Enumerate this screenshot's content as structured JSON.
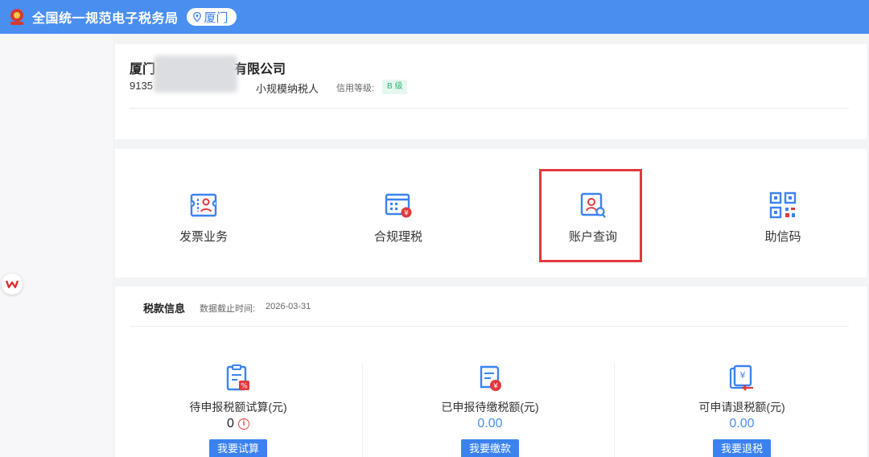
{
  "header": {
    "title": "全国统一规范电子税务局",
    "city": "厦门",
    "colors": {
      "bar": "#4a8ff0",
      "accent": "#3a7de8"
    }
  },
  "company": {
    "name_prefix": "厦门",
    "name_suffix": "有限公司",
    "id_prefix": "9135",
    "taxpayer_type": "小规模纳税人",
    "credit_label": "信用等级:",
    "credit_grade": "B 级"
  },
  "quick_actions": [
    {
      "label": "发票业务",
      "icon": "invoice-icon"
    },
    {
      "label": "合规理税",
      "icon": "compliance-icon"
    },
    {
      "label": "账户查询",
      "icon": "account-search-icon",
      "highlighted": true
    },
    {
      "label": "助信码",
      "icon": "qr-code-icon"
    }
  ],
  "tax_info": {
    "title": "税款信息",
    "date_label": "数据截止时间:",
    "date": "2026-03-31",
    "columns": [
      {
        "label": "待申报税额试算(元)",
        "value": "0",
        "button": "我要试算",
        "icon": "calculator-doc-icon"
      },
      {
        "label": "已申报待缴税额(元)",
        "value": "0.00",
        "button": "我要缴款",
        "icon": "payment-doc-icon"
      },
      {
        "label": "可申请退税额(元)",
        "value": "0.00",
        "button": "我要退税",
        "icon": "refund-doc-icon"
      }
    ]
  },
  "side_badge": "W"
}
